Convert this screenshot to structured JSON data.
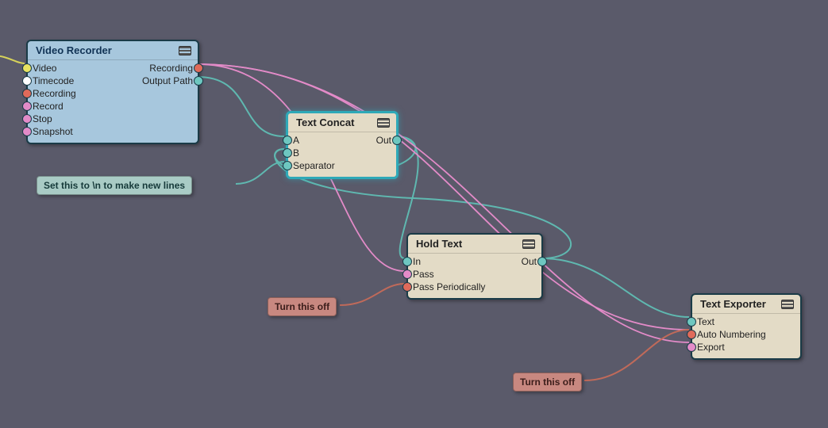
{
  "nodes": {
    "video_recorder": {
      "title": "Video Recorder",
      "inputs": [
        "Video",
        "Timecode",
        "Recording",
        "Record",
        "Stop",
        "Snapshot"
      ],
      "outputs": [
        "Recording",
        "Output Path"
      ]
    },
    "text_concat": {
      "title": "Text Concat",
      "inputs": [
        "A",
        "B",
        "Separator"
      ],
      "outputs": [
        "Out"
      ]
    },
    "hold_text": {
      "title": "Hold Text",
      "inputs": [
        "In",
        "Pass",
        "Pass Periodically"
      ],
      "outputs": [
        "Out"
      ]
    },
    "text_exporter": {
      "title": "Text Exporter",
      "inputs": [
        "Text",
        "Auto Numbering",
        "Export"
      ],
      "outputs": []
    }
  },
  "notes": {
    "separator": "Set this to \\n  to make new lines",
    "pass_periodically": "Turn this off",
    "auto_numbering": "Turn this off"
  },
  "chart_data": {
    "type": "node-graph",
    "nodes": [
      {
        "id": "video_recorder",
        "label": "Video Recorder",
        "inputs": [
          "Video",
          "Timecode",
          "Recording",
          "Record",
          "Stop",
          "Snapshot"
        ],
        "outputs": [
          "Recording",
          "Output Path"
        ]
      },
      {
        "id": "text_concat",
        "label": "Text Concat",
        "inputs": [
          "A",
          "B",
          "Separator"
        ],
        "outputs": [
          "Out"
        ]
      },
      {
        "id": "hold_text",
        "label": "Hold Text",
        "inputs": [
          "In",
          "Pass",
          "Pass Periodically"
        ],
        "outputs": [
          "Out"
        ]
      },
      {
        "id": "text_exporter",
        "label": "Text Exporter",
        "inputs": [
          "Text",
          "Auto Numbering",
          "Export"
        ],
        "outputs": []
      }
    ],
    "edges": [
      {
        "from": "video_recorder.Recording",
        "to": "text_exporter.Auto Numbering"
      },
      {
        "from": "video_recorder.Recording",
        "to": "hold_text.Pass"
      },
      {
        "from": "video_recorder.Recording",
        "to": "text_exporter.Export"
      },
      {
        "from": "video_recorder.Output Path",
        "to": "text_concat.A"
      },
      {
        "from": "text_concat.Out",
        "to": "hold_text.In"
      },
      {
        "from": "text_concat.Out",
        "to": "text_concat.B"
      },
      {
        "from": "hold_text.Out",
        "to": "text_concat.B"
      },
      {
        "from": "hold_text.Out",
        "to": "text_exporter.Text"
      }
    ],
    "annotations": [
      {
        "target": "text_concat.Separator",
        "text": "Set this to \\n  to make new lines"
      },
      {
        "target": "hold_text.Pass Periodically",
        "text": "Turn this off"
      },
      {
        "target": "text_exporter.Auto Numbering",
        "text": "Turn this off"
      }
    ]
  }
}
